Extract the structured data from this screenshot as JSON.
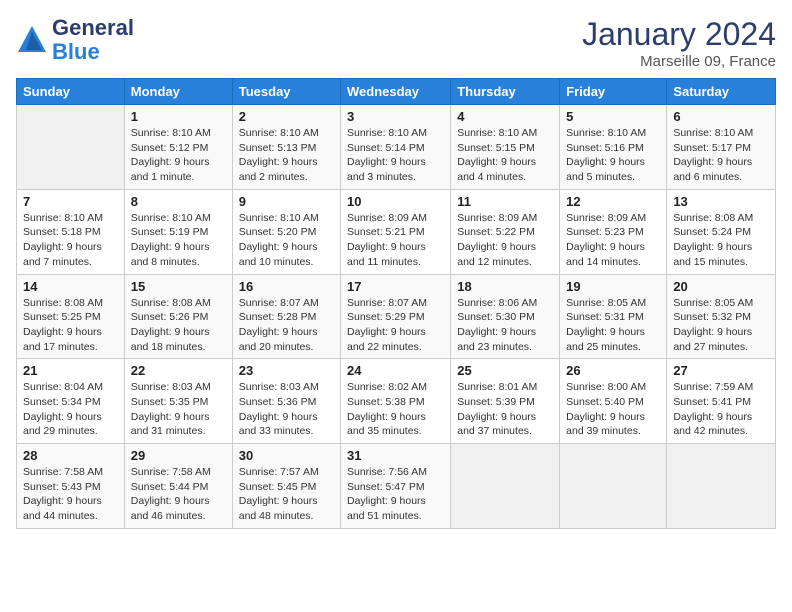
{
  "logo": {
    "general": "General",
    "blue": "Blue"
  },
  "header": {
    "title": "January 2024",
    "subtitle": "Marseille 09, France"
  },
  "days_of_week": [
    "Sunday",
    "Monday",
    "Tuesday",
    "Wednesday",
    "Thursday",
    "Friday",
    "Saturday"
  ],
  "weeks": [
    [
      {
        "day": "",
        "sunrise": "",
        "sunset": "",
        "daylight": ""
      },
      {
        "day": "1",
        "sunrise": "Sunrise: 8:10 AM",
        "sunset": "Sunset: 5:12 PM",
        "daylight": "Daylight: 9 hours and 1 minute."
      },
      {
        "day": "2",
        "sunrise": "Sunrise: 8:10 AM",
        "sunset": "Sunset: 5:13 PM",
        "daylight": "Daylight: 9 hours and 2 minutes."
      },
      {
        "day": "3",
        "sunrise": "Sunrise: 8:10 AM",
        "sunset": "Sunset: 5:14 PM",
        "daylight": "Daylight: 9 hours and 3 minutes."
      },
      {
        "day": "4",
        "sunrise": "Sunrise: 8:10 AM",
        "sunset": "Sunset: 5:15 PM",
        "daylight": "Daylight: 9 hours and 4 minutes."
      },
      {
        "day": "5",
        "sunrise": "Sunrise: 8:10 AM",
        "sunset": "Sunset: 5:16 PM",
        "daylight": "Daylight: 9 hours and 5 minutes."
      },
      {
        "day": "6",
        "sunrise": "Sunrise: 8:10 AM",
        "sunset": "Sunset: 5:17 PM",
        "daylight": "Daylight: 9 hours and 6 minutes."
      }
    ],
    [
      {
        "day": "7",
        "sunrise": "Sunrise: 8:10 AM",
        "sunset": "Sunset: 5:18 PM",
        "daylight": "Daylight: 9 hours and 7 minutes."
      },
      {
        "day": "8",
        "sunrise": "Sunrise: 8:10 AM",
        "sunset": "Sunset: 5:19 PM",
        "daylight": "Daylight: 9 hours and 8 minutes."
      },
      {
        "day": "9",
        "sunrise": "Sunrise: 8:10 AM",
        "sunset": "Sunset: 5:20 PM",
        "daylight": "Daylight: 9 hours and 10 minutes."
      },
      {
        "day": "10",
        "sunrise": "Sunrise: 8:09 AM",
        "sunset": "Sunset: 5:21 PM",
        "daylight": "Daylight: 9 hours and 11 minutes."
      },
      {
        "day": "11",
        "sunrise": "Sunrise: 8:09 AM",
        "sunset": "Sunset: 5:22 PM",
        "daylight": "Daylight: 9 hours and 12 minutes."
      },
      {
        "day": "12",
        "sunrise": "Sunrise: 8:09 AM",
        "sunset": "Sunset: 5:23 PM",
        "daylight": "Daylight: 9 hours and 14 minutes."
      },
      {
        "day": "13",
        "sunrise": "Sunrise: 8:08 AM",
        "sunset": "Sunset: 5:24 PM",
        "daylight": "Daylight: 9 hours and 15 minutes."
      }
    ],
    [
      {
        "day": "14",
        "sunrise": "Sunrise: 8:08 AM",
        "sunset": "Sunset: 5:25 PM",
        "daylight": "Daylight: 9 hours and 17 minutes."
      },
      {
        "day": "15",
        "sunrise": "Sunrise: 8:08 AM",
        "sunset": "Sunset: 5:26 PM",
        "daylight": "Daylight: 9 hours and 18 minutes."
      },
      {
        "day": "16",
        "sunrise": "Sunrise: 8:07 AM",
        "sunset": "Sunset: 5:28 PM",
        "daylight": "Daylight: 9 hours and 20 minutes."
      },
      {
        "day": "17",
        "sunrise": "Sunrise: 8:07 AM",
        "sunset": "Sunset: 5:29 PM",
        "daylight": "Daylight: 9 hours and 22 minutes."
      },
      {
        "day": "18",
        "sunrise": "Sunrise: 8:06 AM",
        "sunset": "Sunset: 5:30 PM",
        "daylight": "Daylight: 9 hours and 23 minutes."
      },
      {
        "day": "19",
        "sunrise": "Sunrise: 8:05 AM",
        "sunset": "Sunset: 5:31 PM",
        "daylight": "Daylight: 9 hours and 25 minutes."
      },
      {
        "day": "20",
        "sunrise": "Sunrise: 8:05 AM",
        "sunset": "Sunset: 5:32 PM",
        "daylight": "Daylight: 9 hours and 27 minutes."
      }
    ],
    [
      {
        "day": "21",
        "sunrise": "Sunrise: 8:04 AM",
        "sunset": "Sunset: 5:34 PM",
        "daylight": "Daylight: 9 hours and 29 minutes."
      },
      {
        "day": "22",
        "sunrise": "Sunrise: 8:03 AM",
        "sunset": "Sunset: 5:35 PM",
        "daylight": "Daylight: 9 hours and 31 minutes."
      },
      {
        "day": "23",
        "sunrise": "Sunrise: 8:03 AM",
        "sunset": "Sunset: 5:36 PM",
        "daylight": "Daylight: 9 hours and 33 minutes."
      },
      {
        "day": "24",
        "sunrise": "Sunrise: 8:02 AM",
        "sunset": "Sunset: 5:38 PM",
        "daylight": "Daylight: 9 hours and 35 minutes."
      },
      {
        "day": "25",
        "sunrise": "Sunrise: 8:01 AM",
        "sunset": "Sunset: 5:39 PM",
        "daylight": "Daylight: 9 hours and 37 minutes."
      },
      {
        "day": "26",
        "sunrise": "Sunrise: 8:00 AM",
        "sunset": "Sunset: 5:40 PM",
        "daylight": "Daylight: 9 hours and 39 minutes."
      },
      {
        "day": "27",
        "sunrise": "Sunrise: 7:59 AM",
        "sunset": "Sunset: 5:41 PM",
        "daylight": "Daylight: 9 hours and 42 minutes."
      }
    ],
    [
      {
        "day": "28",
        "sunrise": "Sunrise: 7:58 AM",
        "sunset": "Sunset: 5:43 PM",
        "daylight": "Daylight: 9 hours and 44 minutes."
      },
      {
        "day": "29",
        "sunrise": "Sunrise: 7:58 AM",
        "sunset": "Sunset: 5:44 PM",
        "daylight": "Daylight: 9 hours and 46 minutes."
      },
      {
        "day": "30",
        "sunrise": "Sunrise: 7:57 AM",
        "sunset": "Sunset: 5:45 PM",
        "daylight": "Daylight: 9 hours and 48 minutes."
      },
      {
        "day": "31",
        "sunrise": "Sunrise: 7:56 AM",
        "sunset": "Sunset: 5:47 PM",
        "daylight": "Daylight: 9 hours and 51 minutes."
      },
      {
        "day": "",
        "sunrise": "",
        "sunset": "",
        "daylight": ""
      },
      {
        "day": "",
        "sunrise": "",
        "sunset": "",
        "daylight": ""
      },
      {
        "day": "",
        "sunrise": "",
        "sunset": "",
        "daylight": ""
      }
    ]
  ]
}
